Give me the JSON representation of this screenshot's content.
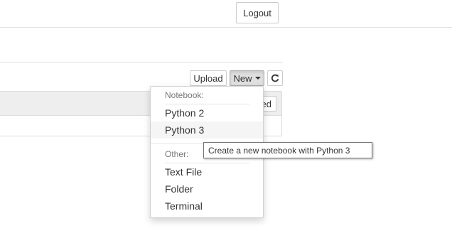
{
  "header": {
    "logout_label": "Logout"
  },
  "toolbar": {
    "upload_label": "Upload",
    "new_label": "New",
    "refresh_icon": "refresh-icon"
  },
  "list": {
    "sort_button_label": "Last Modified"
  },
  "new_menu": {
    "notebook_header": "Notebook:",
    "notebook_items": [
      "Python 2",
      "Python 3"
    ],
    "hovered_item": "Python 3",
    "other_header": "Other:",
    "other_items": [
      "Text File",
      "Folder",
      "Terminal"
    ]
  },
  "tooltip": {
    "text": "Create a new notebook with Python 3"
  }
}
